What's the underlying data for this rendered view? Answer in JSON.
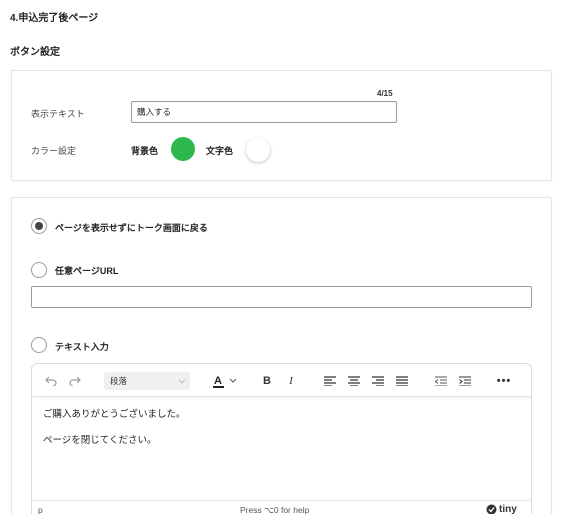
{
  "section_title": "4.申込完了後ページ",
  "button_settings_title": "ボタン設定",
  "button_card": {
    "char_counter": "4/15",
    "display_text_label": "表示テキスト",
    "display_text_value": "購入する",
    "color_label": "カラー設定",
    "bg_color_label": "背景色",
    "text_color_label": "文字色",
    "bg_color": "#2db84d",
    "text_color": "#ffffff"
  },
  "options": {
    "return_label": "ページを表示せずにトーク画面に戻る",
    "url_label": "任意ページURL",
    "url_value": "",
    "text_label": "テキスト入力",
    "selected": "return"
  },
  "editor": {
    "block_format": "段落",
    "content_lines": [
      "ご購入ありがとうございました。",
      "ページを閉じてください。"
    ],
    "status_path": "p",
    "status_help": "Press ⌥0 for help",
    "brand": "tiny"
  }
}
